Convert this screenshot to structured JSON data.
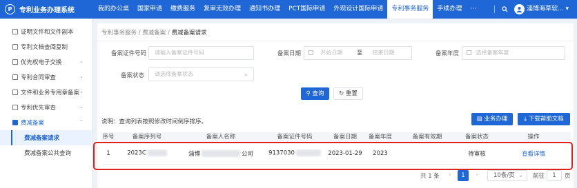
{
  "header": {
    "logo_mark": "P",
    "title": "专利业务办理系统",
    "nav": [
      "我的办公桌",
      "国家申请",
      "缴费服务",
      "复审无效办理",
      "通知书办理",
      "PCT国际申请",
      "外观设计国际申请",
      "专利事务服务",
      "手续办理",
      "···"
    ],
    "active_nav": "专利事务服务",
    "user_name": "淄博海草软...",
    "user_caret": "▾"
  },
  "sidebar": {
    "items": [
      {
        "label": "证明文件和文件副本",
        "chevron": ""
      },
      {
        "label": "专利文档查阅复制",
        "chevron": ""
      },
      {
        "label": "优先权电子交换",
        "chevron": "⌄"
      },
      {
        "label": "专利合同审查",
        "chevron": "⌄"
      },
      {
        "label": "文件和业务专用章备案",
        "chevron": "⌄"
      },
      {
        "label": "专利优先审查",
        "chevron": "⌄"
      },
      {
        "label": "费减备案",
        "chevron": "⌃"
      }
    ],
    "sub_items": [
      "费减备案请求",
      "费减备案公共查询"
    ]
  },
  "breadcrumb": {
    "parts": [
      "专利事务服务",
      "费减备案"
    ],
    "sep": "/",
    "current": "费减备案请求"
  },
  "filters": {
    "cert_label": "备案证件号码",
    "cert_placeholder": "请输入备案证件号码",
    "date_label": "备案日期",
    "start_placeholder": "开始日期",
    "date_to": "至",
    "end_placeholder": "结束日期",
    "year_label": "备案年度",
    "year_placeholder": "选择备案年度",
    "status_label": "备案状态",
    "status_placeholder": "请选择备案状态"
  },
  "actions": {
    "search": "查询",
    "reset": "重置",
    "business": "业务办理",
    "download": "下载帮助文档"
  },
  "note": "说明：查询列表按照修改时间倒序排序。",
  "table": {
    "columns": [
      "序号",
      "备案序列号",
      "备案人名称",
      "备案证件号码",
      "备案日期",
      "备案年度",
      "备案有效期",
      "备案状态",
      "操作"
    ],
    "rows": [
      {
        "index": "1",
        "serial": "2023C",
        "name_prefix": "淄博",
        "name_suffix": "公司",
        "cert": "9137030",
        "date": "2023-01-29",
        "year": "2023",
        "validity": "",
        "status": "待审核",
        "action": "查看详情"
      }
    ]
  },
  "pager": {
    "total": "共 1 条",
    "prev": "‹",
    "page": "1",
    "next": "›",
    "size": "10条/页",
    "goto_label": "前往",
    "goto_value": "1",
    "goto_unit": "页"
  },
  "colors": {
    "primary": "#1f66d6",
    "highlight": "#e0201a"
  }
}
